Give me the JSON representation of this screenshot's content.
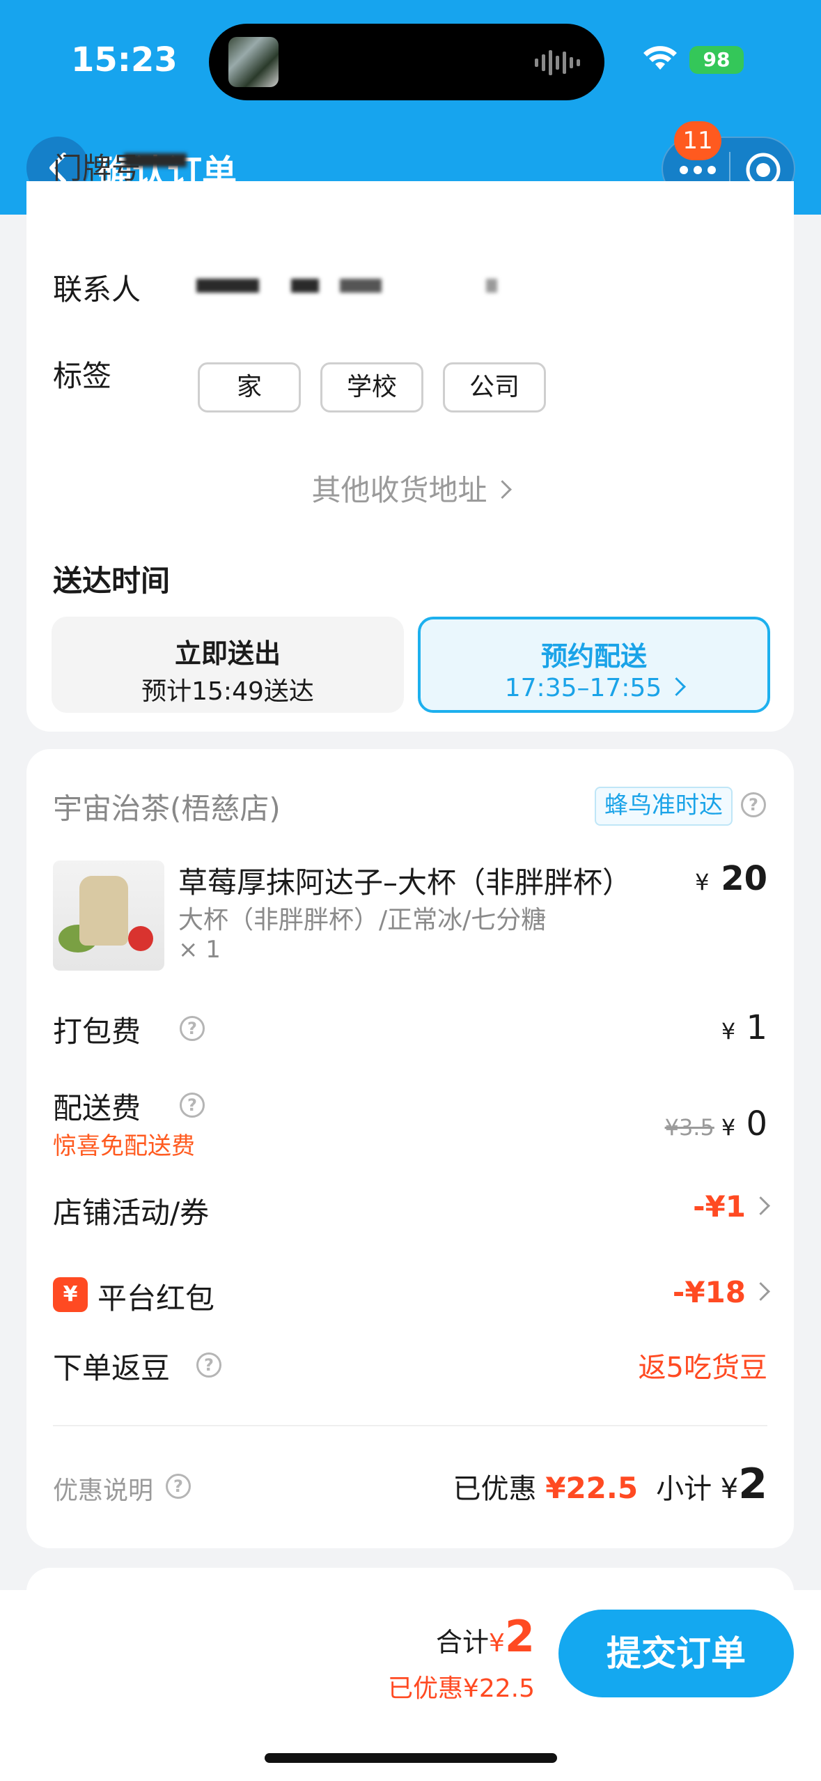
{
  "status_bar": {
    "time": "15:23",
    "battery": "98"
  },
  "nav": {
    "title": "确认订单",
    "badge_count": "11"
  },
  "address": {
    "door_label": "门牌号",
    "contact_label": "联系人",
    "tag_label": "标签",
    "tags": [
      "家",
      "学校",
      "公司"
    ],
    "other_address": "其他收货地址"
  },
  "delivery": {
    "section_title": "送达时间",
    "now": {
      "title": "立即送出",
      "sub": "预计15:49送达"
    },
    "reserve": {
      "title": "预约配送",
      "sub": "17:35–17:55"
    }
  },
  "order": {
    "shop_name": "宇宙治茶(梧慈店)",
    "shop_badge": "蜂鸟准时达",
    "product": {
      "name": "草莓厚抹阿达子–大杯（非胖胖杯）",
      "spec": "大杯（非胖胖杯）/正常冰/七分糖",
      "qty": "× 1",
      "price": "20"
    },
    "packing_fee": {
      "label": "打包费",
      "value": "1"
    },
    "delivery_fee": {
      "label": "配送费",
      "original": "¥3.5",
      "value": "0",
      "note": "惊喜免配送费"
    },
    "shop_promo": {
      "label": "店铺活动/券",
      "value": "-¥1"
    },
    "platform_redpacket": {
      "icon": "¥",
      "label": "平台红包",
      "value": "-¥18"
    },
    "beans": {
      "label": "下单返豆",
      "value": "返5吃货豆"
    },
    "promo_explain": "优惠说明",
    "discounted_label": "已优惠",
    "discounted_value": "¥22.5",
    "subtotal_label": "小计",
    "subtotal_value": "2"
  },
  "footer": {
    "total_label": "合计",
    "total_value": "2",
    "saved": "已优惠¥22.5",
    "submit": "提交订单"
  },
  "colors": {
    "primary": "#17a4ee",
    "accent_red": "#ff4a22",
    "badge_orange": "#ff5a1f"
  }
}
